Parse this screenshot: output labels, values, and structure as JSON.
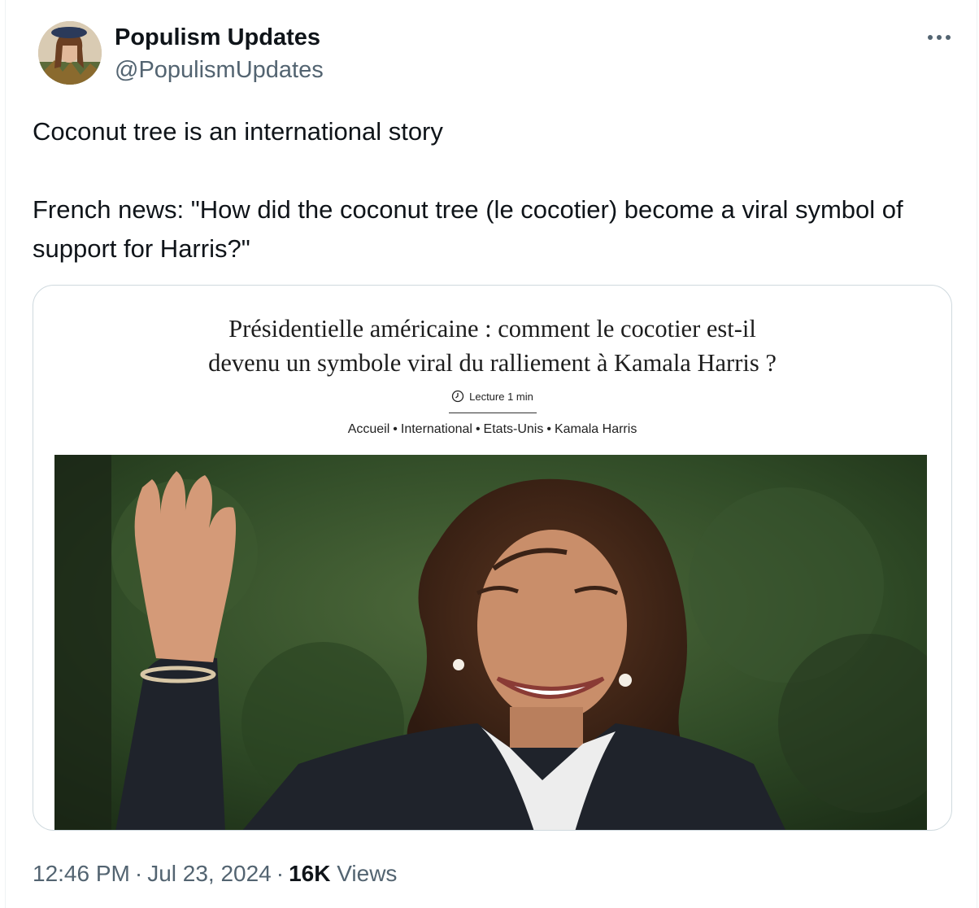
{
  "author": {
    "display_name": "Populism Updates",
    "handle": "@PopulismUpdates",
    "avatar_icon": "profile-avatar"
  },
  "more_icon": "more-horizontal-icon",
  "tweet": {
    "line1": "Coconut tree is an international story",
    "line2": "French news: \"How did the coconut tree (le cocotier) become a viral symbol of support for Harris?\""
  },
  "article": {
    "headline_line1": "Présidentielle américaine : comment le cocotier est-il",
    "headline_line2": "devenu un symbole viral du ralliement à Kamala Harris ?",
    "reading_time": "Lecture 1 min",
    "breadcrumb": [
      "Accueil",
      "International",
      "Etats-Unis",
      "Kamala Harris"
    ],
    "breadcrumb_separator": "•",
    "photo_icon": "article-photo"
  },
  "meta": {
    "time": "12:46 PM",
    "date": "Jul 23, 2024",
    "separator": "·",
    "views_count": "16K",
    "views_label": "Views"
  },
  "colors": {
    "text_primary": "#0f1419",
    "text_secondary": "#536471",
    "card_border": "#cfd9de"
  }
}
